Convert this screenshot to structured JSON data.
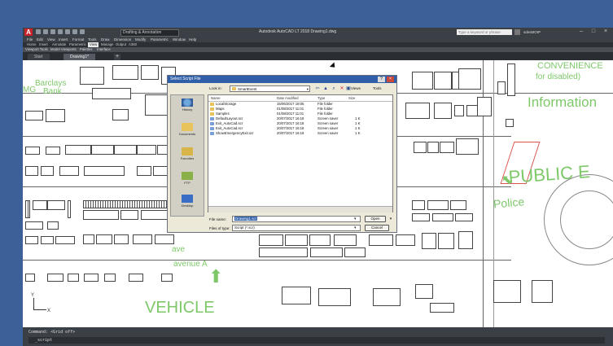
{
  "title_bar": {
    "title": "Autodesk AutoCAD LT 2018   Drawing1.dwg",
    "workspace": "Drafting & Annotation",
    "search_placeholder": "Type a keyword or phrase",
    "user": "sdesMOIP"
  },
  "menu": [
    "File",
    "Edit",
    "View",
    "Insert",
    "Format",
    "Tools",
    "Draw",
    "Dimension",
    "Modify",
    "Parametric",
    "Window",
    "Help"
  ],
  "ribbon_tabs": [
    "Home",
    "Insert",
    "Annotate",
    "Parametric",
    "View",
    "Manage",
    "Output",
    "A360"
  ],
  "ribbon_active_tab": "View",
  "panels": [
    "Viewport Tools",
    "Model Viewports",
    "Palettes",
    "Interface"
  ],
  "doc_tabs": [
    "Start",
    "Drawing1*"
  ],
  "drawing": {
    "labels": [
      "Barclays",
      "Bank",
      "MG",
      "CONVENIENCE",
      "for disabled)",
      "Information",
      "PUBLIC E",
      "Police",
      "ave",
      "ave",
      "ave",
      "avenue  A",
      "VEHICLE"
    ]
  },
  "ucs": {
    "x": "X",
    "y": "Y"
  },
  "command": {
    "history": "Command:  <Grid off>",
    "prompt": "_script"
  },
  "dialog": {
    "title": "Select Script File",
    "look_in_label": "Look in:",
    "look_in_value": "SmartEvent",
    "views_label": "Views",
    "tools_label": "Tools",
    "places": [
      "History",
      "Documents",
      "Favorites",
      "FTP",
      "Desktop"
    ],
    "columns": [
      "Name",
      "Date modified",
      "Type",
      "Size"
    ],
    "files": [
      {
        "name": "LocalStorage",
        "date": "15/06/2017 18:05",
        "type": "File folder",
        "size": ""
      },
      {
        "name": "Maps",
        "date": "01/08/2017 11:01",
        "type": "File folder",
        "size": ""
      },
      {
        "name": "Samples",
        "date": "01/08/2017 11:01",
        "type": "File folder",
        "size": ""
      },
      {
        "name": "DefaultLayout.scr",
        "date": "20/07/2017 16:18",
        "type": "Screen saver",
        "size": "1 K"
      },
      {
        "name": "Exit_AutoCad.scr",
        "date": "20/07/2017 16:18",
        "type": "Screen saver",
        "size": "1 K"
      },
      {
        "name": "Exit_AutoCad.scr",
        "date": "20/07/2017 16:18",
        "type": "Screen saver",
        "size": "1 K"
      },
      {
        "name": "ShowEmergencyExit.scr",
        "date": "20/07/2017 16:18",
        "type": "Screen saver",
        "size": "1 K"
      }
    ],
    "file_name_label": "File name:",
    "file_name_value": "Drawing1.scr",
    "file_type_label": "Files of type:",
    "file_type_value": "Script (*.scr)",
    "open_label": "Open",
    "cancel_label": "Cancel"
  },
  "colors": {
    "desktop": "#3c6198",
    "app_chrome": "#3b3f46",
    "drawing_text": "#7ec86a",
    "dialog_title": "#2f5fa8",
    "dialog_body": "#ece9d8"
  }
}
